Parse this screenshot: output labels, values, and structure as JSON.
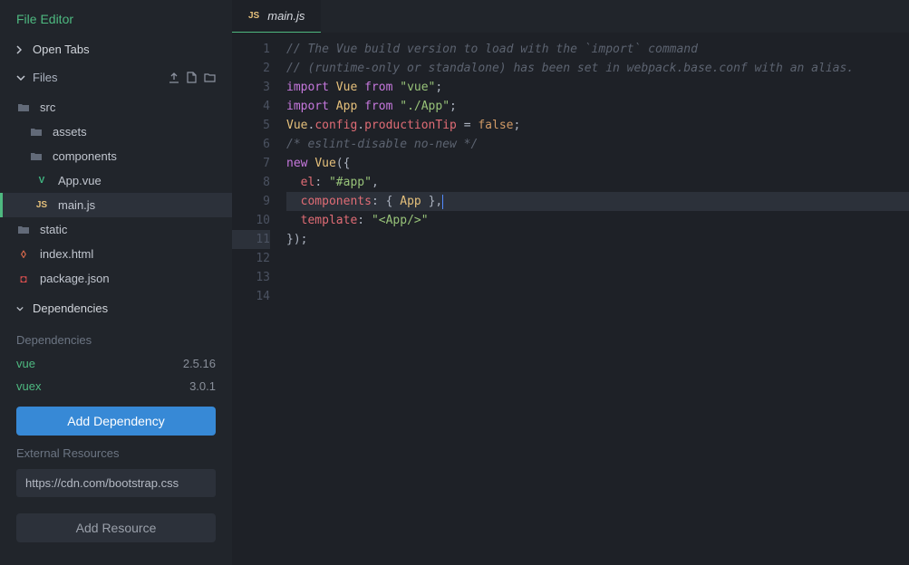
{
  "sidebar": {
    "title": "File Editor",
    "sections": {
      "openTabs": "Open Tabs",
      "files": "Files",
      "dependencies": "Dependencies"
    },
    "tree": {
      "src": "src",
      "assets": "assets",
      "components": "components",
      "appvue": "App.vue",
      "mainjs": "main.js",
      "static": "static",
      "indexhtml": "index.html",
      "packagejson": "package.json"
    },
    "deps": {
      "label": "Dependencies",
      "items": [
        {
          "name": "vue",
          "version": "2.5.16"
        },
        {
          "name": "vuex",
          "version": "3.0.1"
        }
      ],
      "addBtn": "Add Dependency",
      "extLabel": "External Resources",
      "extValue": "https://cdn.com/bootstrap.css",
      "addResBtn": "Add Resource"
    }
  },
  "tab": {
    "filename": "main.js",
    "iconLabel": "JS"
  },
  "code": {
    "lines": [
      {
        "n": 1,
        "html": "<span class='c-comment'>// The Vue build version to load with the `import` command</span>"
      },
      {
        "n": 2,
        "html": "<span class='c-comment'>// (runtime-only or standalone) has been set in webpack.base.conf with an alias.</span>"
      },
      {
        "n": 3,
        "html": "<span class='c-key'>import</span> <span class='c-var'>Vue</span> <span class='c-key'>from</span> <span class='c-str'>\"vue\"</span><span class='c-punc'>;</span>"
      },
      {
        "n": 4,
        "html": "<span class='c-key'>import</span> <span class='c-var'>App</span> <span class='c-key'>from</span> <span class='c-str'>\"./App\"</span><span class='c-punc'>;</span>"
      },
      {
        "n": 5,
        "html": ""
      },
      {
        "n": 6,
        "html": "<span class='c-var'>Vue</span><span class='c-punc'>.</span><span class='c-prop'>config</span><span class='c-punc'>.</span><span class='c-prop'>productionTip</span> <span class='c-punc'>=</span> <span class='c-const'>false</span><span class='c-punc'>;</span>"
      },
      {
        "n": 7,
        "html": ""
      },
      {
        "n": 8,
        "html": "<span class='c-comment'>/* eslint-disable no-new */</span>"
      },
      {
        "n": 9,
        "html": "<span class='c-key'>new</span> <span class='c-var'>Vue</span><span class='c-punc'>({</span>"
      },
      {
        "n": 10,
        "html": "  <span class='c-prop'>el</span><span class='c-punc'>:</span> <span class='c-str'>\"#app\"</span><span class='c-punc'>,</span>"
      },
      {
        "n": 11,
        "html": "  <span class='c-prop'>components</span><span class='c-punc'>:</span> <span class='c-punc'>{</span> <span class='c-var'>App</span> <span class='c-punc'>},</span>",
        "current": true
      },
      {
        "n": 12,
        "html": "  <span class='c-prop'>template</span><span class='c-punc'>:</span> <span class='c-str'>\"&lt;App/&gt;\"</span>"
      },
      {
        "n": 13,
        "html": "<span class='c-punc'>});</span>"
      },
      {
        "n": 14,
        "html": ""
      }
    ]
  }
}
